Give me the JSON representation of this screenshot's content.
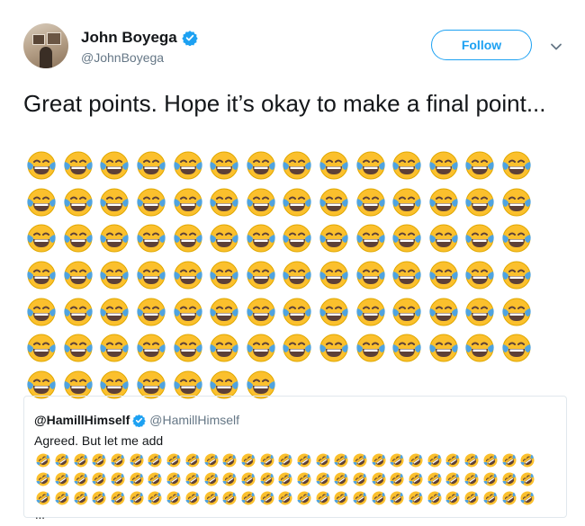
{
  "author": {
    "display_name": "John Boyega",
    "handle": "@JohnBoyega",
    "verified": true,
    "avatar": "avatar-photo"
  },
  "actions": {
    "follow_label": "Follow",
    "menu_icon": "chevron-down-icon"
  },
  "tweet": {
    "text": "Great points. Hope it’s okay to make a final point...",
    "emoji": "face-with-tears-of-joy",
    "emoji_count": 91
  },
  "quoted_tweet": {
    "display_name": "@HamillHimself",
    "handle": "@HamillHimself",
    "verified": true,
    "text": "Agreed. But let me add",
    "emoji": "rolling-on-the-floor-laughing",
    "emoji_count": 81,
    "truncation": "..."
  },
  "colors": {
    "accent": "#1da1f2",
    "secondary_text": "#657786",
    "border": "#e1e8ed"
  }
}
